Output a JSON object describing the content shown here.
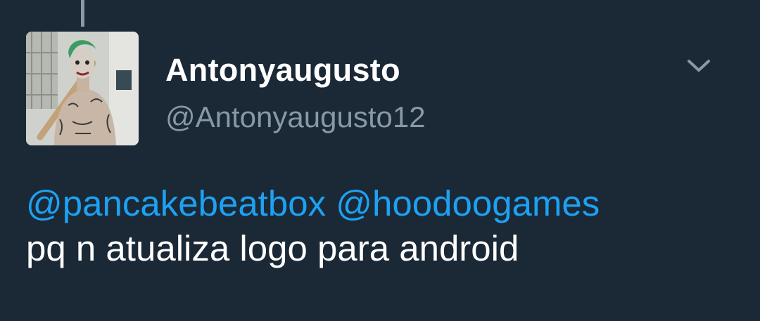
{
  "user": {
    "display_name": "Antonyaugusto",
    "handle": "@Antonyaugusto12"
  },
  "tweet": {
    "mentions": [
      "@pancakebeatbox",
      "@hoodoogames"
    ],
    "text": "pq n atualiza logo para android"
  },
  "icons": {
    "menu": "chevron-down-icon"
  },
  "colors": {
    "background": "#1b2836",
    "link": "#1da1f2",
    "secondary_text": "#8899a6",
    "primary_text": "#ffffff"
  }
}
